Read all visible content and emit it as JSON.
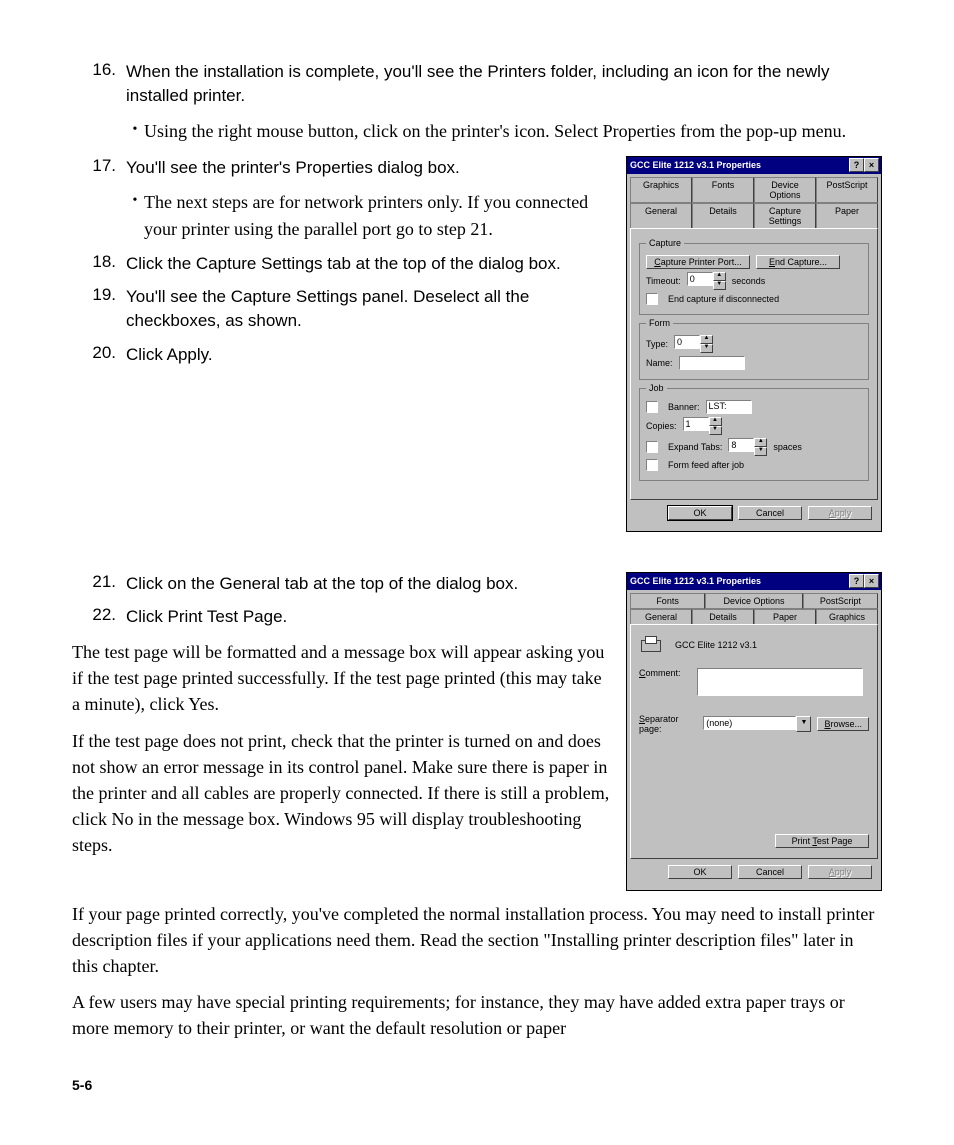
{
  "page_number": "5-6",
  "steps": {
    "s16": "When the installation is complete, you'll see the Printers folder, including an icon for the newly installed printer.",
    "s16_bullet": "Using the right mouse button, click on the printer's icon. Select Properties from the pop-up menu.",
    "s17": "You'll see the printer's Properties dialog box.",
    "s17_bullet": "The next steps are for network printers only. If you connected your printer using the parallel port go to step 21.",
    "s18": "Click the Capture Settings tab at the top of the dialog box.",
    "s19": "You'll see the Capture Settings panel. Deselect all the checkboxes, as shown.",
    "s20": "Click Apply.",
    "s21": "Click on the General tab at the top of the dialog box.",
    "s22": "Click Print Test Page."
  },
  "paras": {
    "p1": "The test page will be formatted and a message box will appear asking you if the test page printed successfully. If the test page printed (this may take a minute), click Yes.",
    "p2": "If the test page does not print, check that the printer is turned on and does not show an error message in its control panel. Make sure there is paper in the printer and all cables are properly connected. If there is still a problem, click No in the message box. Windows 95 will display troubleshooting steps.",
    "p3": "If your page printed correctly, you've completed the normal installation process. You may need to install printer description files if your applications need them. Read the section \"Installing printer description files\" later in this chapter.",
    "p4": "A few users may have special printing requirements; for instance, they may have added extra paper trays or more memory to their printer, or want the default resolution or paper"
  },
  "dialog1": {
    "title": "GCC Elite 1212 v3.1 Properties",
    "tabs_back": [
      "Graphics",
      "Fonts",
      "Device Options",
      "PostScript"
    ],
    "tabs_front": [
      "General",
      "Details",
      "Capture Settings",
      "Paper"
    ],
    "capture": {
      "legend": "Capture",
      "btn_capture_port": "Capture Printer Port...",
      "btn_end_capture": "End Capture...",
      "timeout_label": "Timeout:",
      "timeout_value": "0",
      "timeout_unit": "seconds",
      "chk_end_disc": "End capture if disconnected"
    },
    "form": {
      "legend": "Form",
      "type_label": "Type:",
      "type_value": "0",
      "name_label": "Name:",
      "name_value": ""
    },
    "job": {
      "legend": "Job",
      "banner_label": "Banner:",
      "banner_value": "LST:",
      "copies_label": "Copies:",
      "copies_value": "1",
      "expand_label": "Expand Tabs:",
      "expand_value": "8",
      "expand_unit": "spaces",
      "formfeed_label": "Form feed after job"
    },
    "buttons": {
      "ok": "OK",
      "cancel": "Cancel",
      "apply": "Apply"
    }
  },
  "dialog2": {
    "title": "GCC Elite 1212 v3.1 Properties",
    "tabs_back": [
      "Fonts",
      "Device Options",
      "PostScript"
    ],
    "tabs_front": [
      "General",
      "Details",
      "Paper",
      "Graphics"
    ],
    "printer_name": "GCC Elite 1212 v3.1",
    "comment_label": "Comment:",
    "comment_value": "",
    "separator_label": "Separator page:",
    "separator_value": "(none)",
    "browse": "Browse...",
    "print_test": "Print Test Page",
    "buttons": {
      "ok": "OK",
      "cancel": "Cancel",
      "apply": "Apply"
    }
  }
}
